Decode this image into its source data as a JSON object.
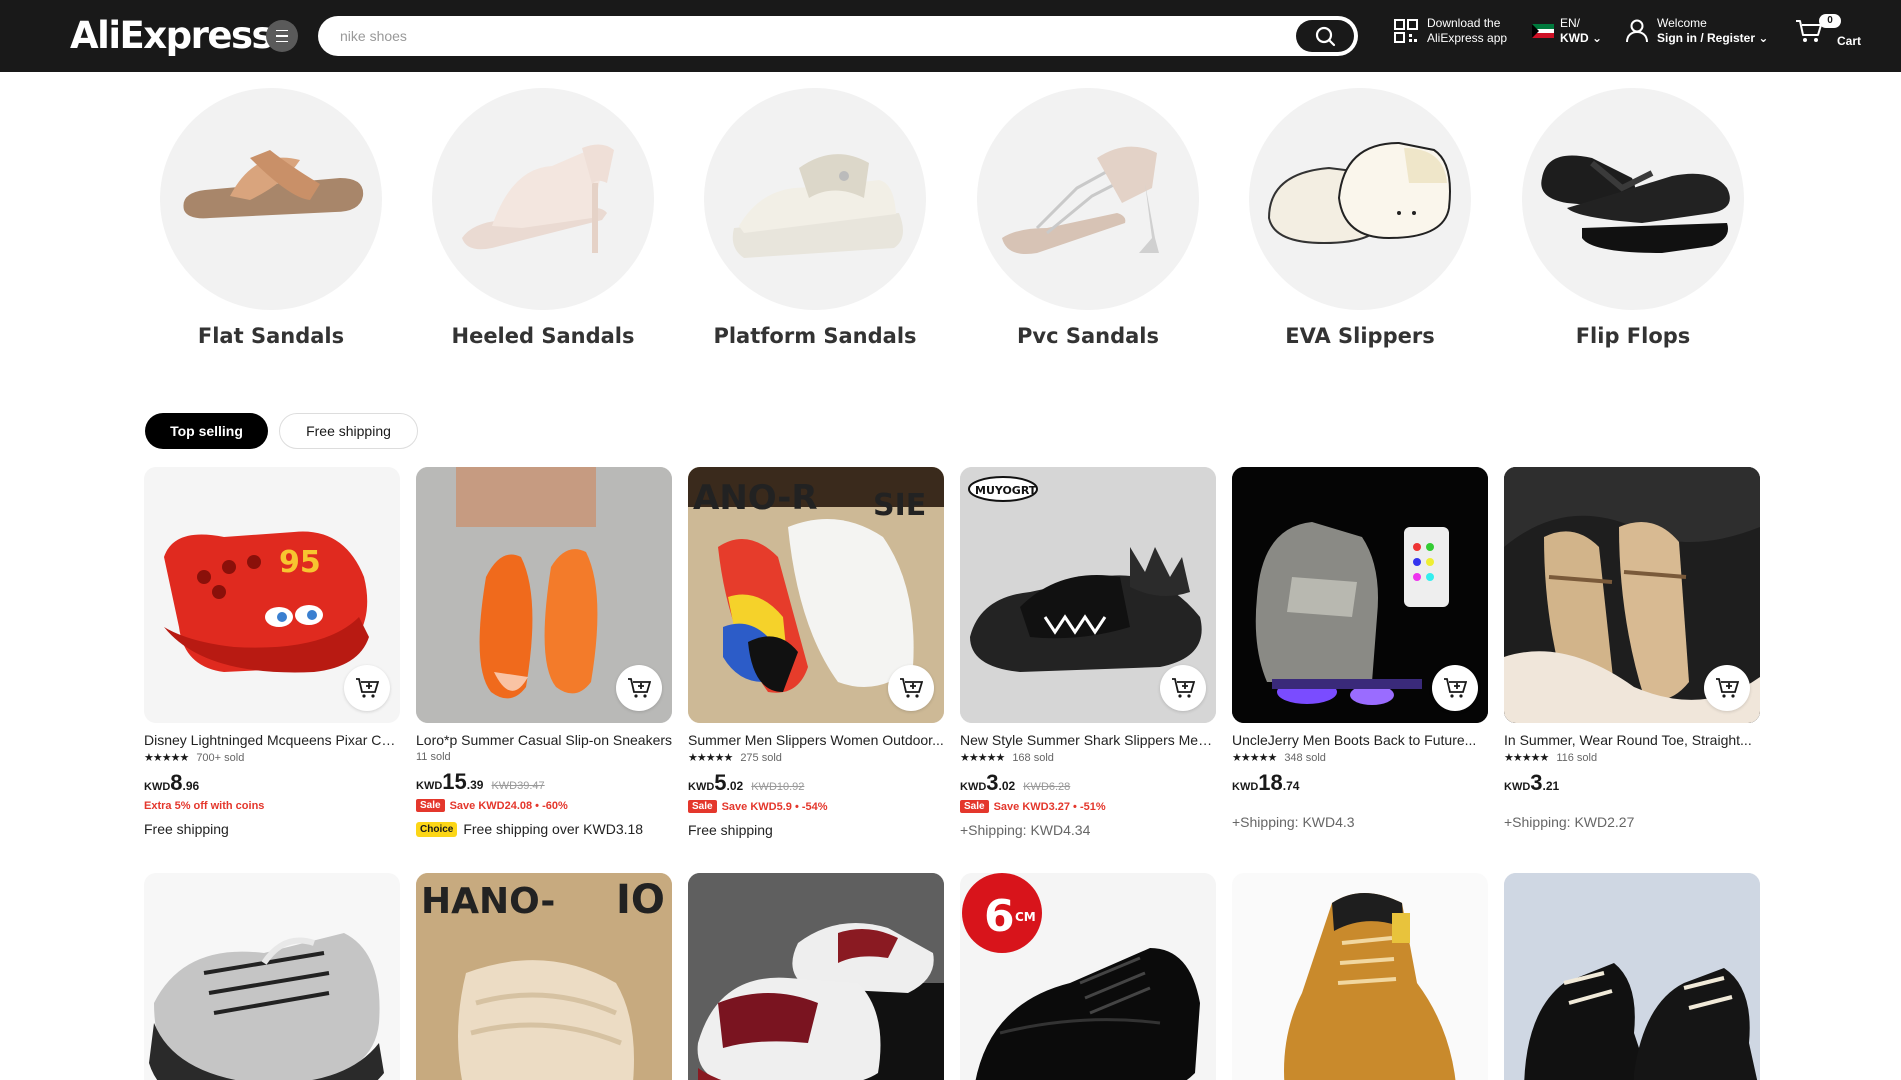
{
  "header": {
    "logo": "AliExpress",
    "search_placeholder": "nike shoes",
    "download_line1": "Download the",
    "download_line2": "AliExpress app",
    "lang_line1": "EN/",
    "lang_line2": "KWD",
    "welcome": "Welcome",
    "sign_in": "Sign in / Register",
    "cart_count": "0",
    "cart_label": "Cart"
  },
  "categories": [
    {
      "label": "Flat Sandals"
    },
    {
      "label": "Heeled Sandals"
    },
    {
      "label": "Platform Sandals"
    },
    {
      "label": "Pvc Sandals"
    },
    {
      "label": "EVA Slippers"
    },
    {
      "label": "Flip Flops"
    }
  ],
  "tabs": {
    "top_selling": "Top selling",
    "free_shipping": "Free shipping"
  },
  "products": [
    {
      "title": "Disney Lightninged Mcqueens Pixar Cars...",
      "stars": "★★★★★",
      "sold": "700+ sold",
      "cur": "KWD",
      "int": "8",
      "dec": ".96",
      "old": "",
      "extra": "Extra 5% off with coins",
      "ship": "Free shipping"
    },
    {
      "title": "Loro*p Summer Casual Slip-on Sneakers",
      "stars": "",
      "sold": "11 sold",
      "cur": "KWD",
      "int": "15",
      "dec": ".39",
      "old": "KWD39.47",
      "sale": "Sale",
      "promo": "Save KWD24.08 • -60%",
      "choice": "Choice",
      "ship": "Free shipping over KWD3.18"
    },
    {
      "title": "Summer Men Slippers Women Outdoor...",
      "stars": "★★★★★",
      "sold": "275 sold",
      "cur": "KWD",
      "int": "5",
      "dec": ".02",
      "old": "KWD10.92",
      "sale": "Sale",
      "promo": "Save KWD5.9 • -54%",
      "ship": "Free shipping"
    },
    {
      "title": "New Style Summer Shark Slippers Men...",
      "stars": "★★★★★",
      "sold": "168 sold",
      "cur": "KWD",
      "int": "3",
      "dec": ".02",
      "old": "KWD6.28",
      "sale": "Sale",
      "promo": "Save KWD3.27 • -51%",
      "ship": "+Shipping: KWD4.34"
    },
    {
      "title": "UncleJerry Men Boots Back to Future...",
      "stars": "★★★★★",
      "sold": "348 sold",
      "cur": "KWD",
      "int": "18",
      "dec": ".74",
      "old": "",
      "ship": "+Shipping: KWD4.3"
    },
    {
      "title": "In Summer, Wear Round Toe, Straight...",
      "stars": "★★★★★",
      "sold": "116 sold",
      "cur": "KWD",
      "int": "3",
      "dec": ".21",
      "old": "",
      "ship": "+Shipping: KWD2.27"
    }
  ],
  "row2": {
    "shoe_height_badge": "6",
    "shoe_height_unit": "CM"
  },
  "colors": {
    "header_bg": "#191919",
    "sale_red": "#e4372c",
    "choice_yellow": "#fcd617"
  }
}
